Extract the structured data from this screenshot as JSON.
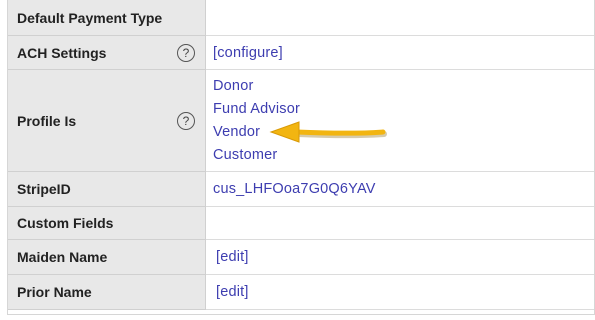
{
  "rows": [
    {
      "label": "Default Payment Type",
      "value": ""
    },
    {
      "label": "ACH Settings",
      "value": "[configure]"
    },
    {
      "label": "Profile Is",
      "options": [
        "Donor",
        "Fund Advisor",
        "Vendor",
        "Customer"
      ]
    },
    {
      "label": "StripeID",
      "value": "cus_LHFOoa7G0Q6YAV"
    },
    {
      "label": "Custom Fields",
      "value": ""
    },
    {
      "label": "Maiden Name",
      "value": "[edit]"
    },
    {
      "label": "Prior Name",
      "value": "[edit]"
    }
  ],
  "help_glyph": "?",
  "colors": {
    "link": "#3d3db0",
    "label_bg": "#e8e8e8",
    "arrow": "#f2b511"
  },
  "icons": {
    "help": "help-circle-icon",
    "arrow": "arrow-left-icon"
  }
}
